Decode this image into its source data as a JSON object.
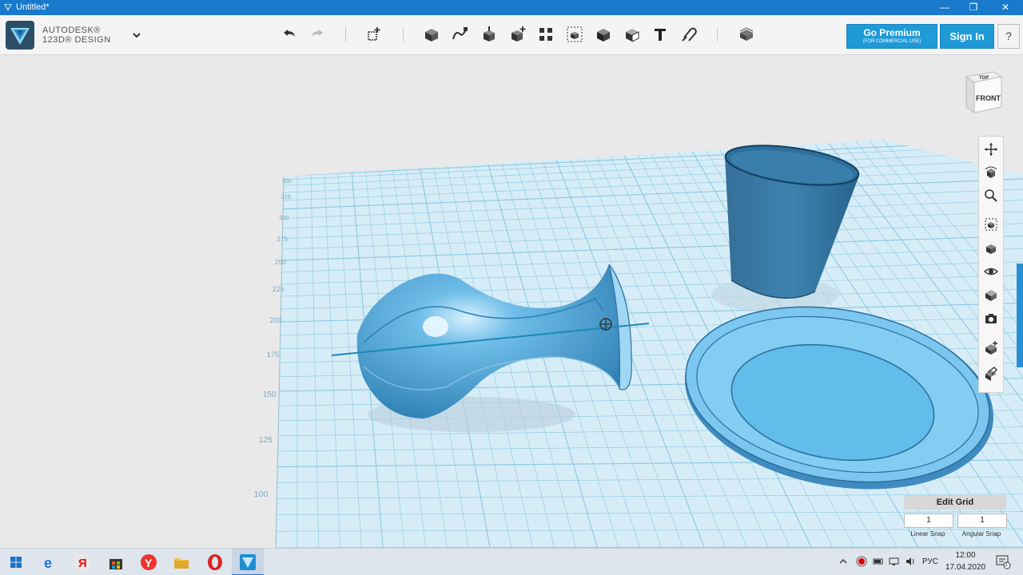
{
  "window": {
    "title": "Untitled*"
  },
  "brand": {
    "line1": "AUTODESK®",
    "line2": "123D® DESIGN"
  },
  "toolbar": {
    "tools": [
      "undo-icon",
      "redo-icon",
      "primitives-icon",
      "sketch-icon",
      "construct-icon",
      "modify-icon",
      "pattern-icon",
      "grouping-icon",
      "combine-icon",
      "measure-icon",
      "text-icon",
      "snap-icon",
      "materials-icon"
    ]
  },
  "premium": {
    "label": "Go Premium",
    "sub": "(FOR COMMERCIAL USE)"
  },
  "signin": {
    "label": "Sign In"
  },
  "help": {
    "label": "?"
  },
  "viewcube": {
    "top": "TOP",
    "front": "FRONT"
  },
  "ruler": {
    "labels": [
      "350",
      "325",
      "300",
      "275",
      "250",
      "225",
      "200",
      "175",
      "150",
      "125",
      "100"
    ]
  },
  "nav": {
    "items": [
      "pan-icon",
      "orbit-icon",
      "zoom-icon",
      "fit-icon",
      "view-icon",
      "visibility-icon",
      "materials-view-icon",
      "camera-icon",
      "grid-icon",
      "snap-tool-icon"
    ]
  },
  "edit_grid": {
    "title": "Edit Grid",
    "linear_value": "1",
    "angular_value": "1",
    "linear_label": "Linear Snap",
    "angular_label": "Angular Snap"
  },
  "taskbar": {
    "lang": "РУС",
    "time": "12:00",
    "date": "17.04.2020",
    "notif_count": "1"
  },
  "colors": {
    "accent": "#1f9ad6",
    "model": "#4aa6db",
    "grid_line": "#8cc7e0",
    "grid_bg": "#d4ecf6"
  }
}
